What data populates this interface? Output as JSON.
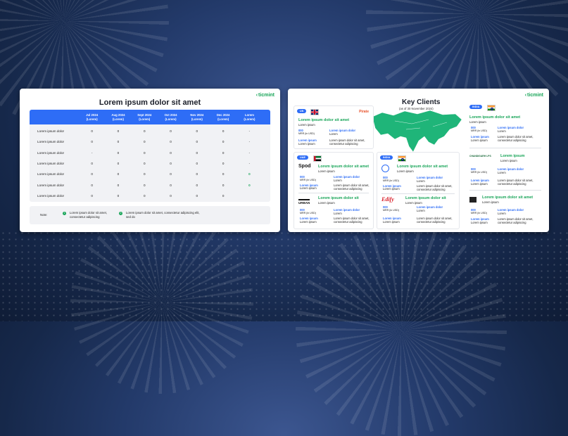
{
  "brand": "ticmint",
  "left_slide": {
    "title": "Lorem ipsum dolor sit amet",
    "header": [
      "",
      "Jul 2024\n(Lorem)",
      "Aug 2024\n(Lorem)",
      "Sept 2024\n(Lorem)",
      "Oct 2024\n(Lorem)",
      "Nov 2024\n(Lorem)",
      "Dec 2024\n(Lorem)",
      "Lorem\n(Lorem)"
    ],
    "rows": [
      [
        "Lorem ipsum dolor",
        "0",
        "0",
        "0",
        "0",
        "0",
        "0",
        "-"
      ],
      [
        "Lorem ipsum dolor",
        "0",
        "0",
        "0",
        "0",
        "0",
        "0",
        "-"
      ],
      [
        "Lorem ipsum dolor",
        "-",
        "0",
        "0",
        "0",
        "0",
        "0",
        "-"
      ],
      [
        "Lorem ipsum dolor",
        "0",
        "0",
        "0",
        "0",
        "0",
        "0",
        "-"
      ],
      [
        "Lorem ipsum dolor",
        "0",
        "0",
        "0",
        "0",
        "0",
        "0",
        "0"
      ],
      [
        "Lorem ipsum dolor",
        "0",
        "0",
        "0",
        "0",
        "0",
        "0",
        "0"
      ],
      [
        "Lorem ipsum dolor",
        "0",
        "0",
        "0",
        "0",
        "0",
        "0",
        ""
      ]
    ],
    "note_label": "Note:",
    "note_1_num": "1",
    "note_1": "Lorem ipsum dolor sit amet, consectetur adipiscing",
    "note_2_num": "2",
    "note_2": "Lorem ipsum dolor sit amet, consectetur adipiscing elit, sed do",
    "accent": "#2e6df6",
    "green": "#18a558"
  },
  "right_slide": {
    "title": "Key Clients",
    "subtitle": "(as of 30 November 2024)",
    "uk": {
      "tag": "UK",
      "logo": "Pirate",
      "heading": "Lorem ipsum dolor sit amet",
      "sub": "Lorem ipsum",
      "mrr_val": "000",
      "mrr_label": "MRR (in USD)",
      "k1": "Lorem ipsum",
      "k2": "Lorem ipsum",
      "v1": "Lorem ipsum dolor",
      "v1b": "Lorem",
      "v2": "Lorem ipsum dolor sit amet, consectetur adipiscing"
    },
    "uae": {
      "tag": "UAE",
      "logo1": "Spod",
      "c1_heading": "Lorem ipsum dolor sit amet",
      "c1_sub": "Lorem ipsum",
      "c1_mrr_val": "000",
      "c1_mrr_label": "MRR (in USD)",
      "c1_k1": "Lorem ipsum",
      "c1_k2": "Lorem ipsum",
      "c1_v1": "Lorem ipsum dolor",
      "c1_v1b": "Lorem",
      "c1_v2": "Lorem ipsum dolor sit amet, consectetur adipiscing",
      "logo2": "URBAN",
      "c2_heading": "Lorem ipsum dolor sit",
      "c2_sub": "Lorem ipsum",
      "c2_mrr_val": "000",
      "c2_mrr_label": "MRR (in USD)",
      "c2_k1": "Lorem ipsum",
      "c2_k2": "Lorem ipsum",
      "c2_v1": "Lorem ipsum dolor",
      "c2_v1b": "Lorem",
      "c2_v2": "Lorem ipsum dolor sit amet, consectetur adipiscing"
    },
    "india_mid": {
      "tag": "INDIA",
      "c1_heading": "Lorem ipsum dolor sit amet",
      "c1_sub": "Lorem ipsum",
      "c1_mrr_val": "000",
      "c1_mrr_label": "MRR (in USD)",
      "c1_k1": "Lorem ipsum",
      "c1_k2": "Lorem ipsum",
      "c1_v1": "Lorem ipsum dolor",
      "c1_v1b": "Lorem",
      "c1_v2": "Lorem ipsum dolor sit amet, consectetur adipiscing",
      "logo2": "Edify",
      "c2_heading": "Lorem ipsum dolor sit",
      "c2_sub": "Lorem ipsum",
      "c2_mrr_val": "000",
      "c2_mrr_label": "MRR (in USD)",
      "c2_k1": "Lorem ipsum",
      "c2_k2": "Lorem ipsum",
      "c2_v1": "Lorem ipsum dolor",
      "c2_v1b": "Lorem",
      "c2_v2": "Lorem ipsum dolor sit amet, consectetur adipiscing"
    },
    "india_right": {
      "tag": "INDIA",
      "c1_heading": "Lorem ipsum dolor sit amet",
      "c1_sub": "Lorem ipsum",
      "c1_mrr_val": "000",
      "c1_mrr_label": "MRR (in USD)",
      "c1_k1": "Lorem ipsum",
      "c1_k2": "Lorem ipsum",
      "c1_v1": "Lorem ipsum dolor",
      "c1_v1b": "Lorem",
      "c1_v2": "Lorem ipsum dolor sit amet, consectetur adipiscing",
      "logo2": "CHANDIGARH LPS",
      "c2_heading": "Lorem ipsum",
      "c2_sub": "Lorem ipsum",
      "c2_mrr_val": "000",
      "c2_mrr_label": "MRR (in USD)",
      "c2_k1": "Lorem ipsum",
      "c2_k2": "Lorem ipsum",
      "c2_v1": "Lorem ipsum dolor",
      "c2_v1b": "Lorem",
      "c2_v2": "Lorem ipsum dolor sit amet, consectetur adipiscing",
      "c3_heading": "Lorem ipsum dolor sit amet",
      "c3_sub": "Lorem ipsum",
      "c3_mrr_val": "000",
      "c3_mrr_label": "MRR (in USD)",
      "c3_k1": "Lorem ipsum",
      "c3_k2": "Lorem ipsum",
      "c3_v1": "Lorem ipsum dolor",
      "c3_v1b": "Lorem",
      "c3_v2": "Lorem ipsum dolor sit amet, consectetur adipiscing"
    },
    "map_color": "#1fb579"
  }
}
